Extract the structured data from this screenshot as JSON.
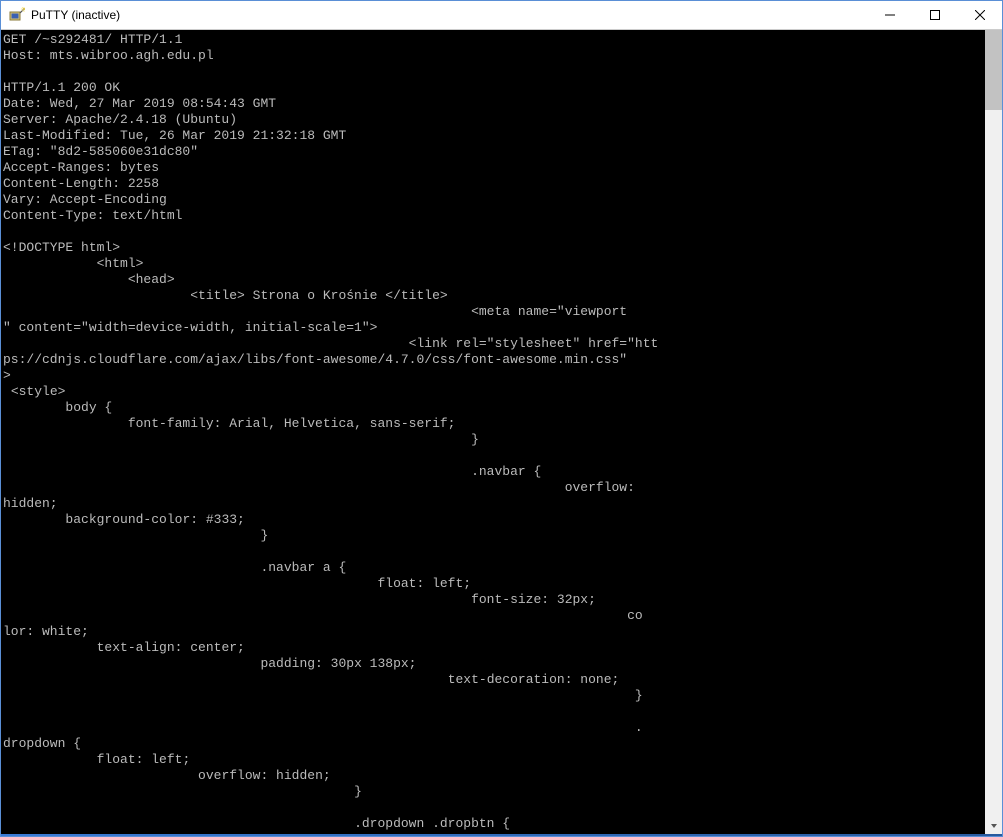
{
  "titlebar": {
    "title": "PuTTY (inactive)"
  },
  "terminal": {
    "lines": [
      "GET /~s292481/ HTTP/1.1",
      "Host: mts.wibroo.agh.edu.pl",
      "",
      "HTTP/1.1 200 OK",
      "Date: Wed, 27 Mar 2019 08:54:43 GMT",
      "Server: Apache/2.4.18 (Ubuntu)",
      "Last-Modified: Tue, 26 Mar 2019 21:32:18 GMT",
      "ETag: \"8d2-585060e31dc80\"",
      "Accept-Ranges: bytes",
      "Content-Length: 2258",
      "Vary: Accept-Encoding",
      "Content-Type: text/html",
      "",
      "<!DOCTYPE html>",
      "            <html>",
      "                <head>",
      "                        <title> Strona o Krośnie </title>",
      "                                                            <meta name=\"viewport",
      "\" content=\"width=device-width, initial-scale=1\">",
      "                                                    <link rel=\"stylesheet\" href=\"htt",
      "ps://cdnjs.cloudflare.com/ajax/libs/font-awesome/4.7.0/css/font-awesome.min.css\"",
      ">",
      " <style>",
      "        body {",
      "                font-family: Arial, Helvetica, sans-serif;",
      "                                                            }",
      "",
      "                                                            .navbar {",
      "                                                                        overflow:",
      "hidden;",
      "        background-color: #333;",
      "                                 }",
      "",
      "                                 .navbar a {",
      "                                                float: left;",
      "                                                            font-size: 32px;",
      "                                                                                co",
      "lor: white;",
      "            text-align: center;",
      "                                 padding: 30px 138px;",
      "                                                         text-decoration: none;",
      "                                                                                 }",
      "",
      "                                                                                 .",
      "dropdown {",
      "            float: left;",
      "                         overflow: hidden;",
      "                                             }",
      "",
      "                                             .dropdown .dropbtn {"
    ]
  }
}
